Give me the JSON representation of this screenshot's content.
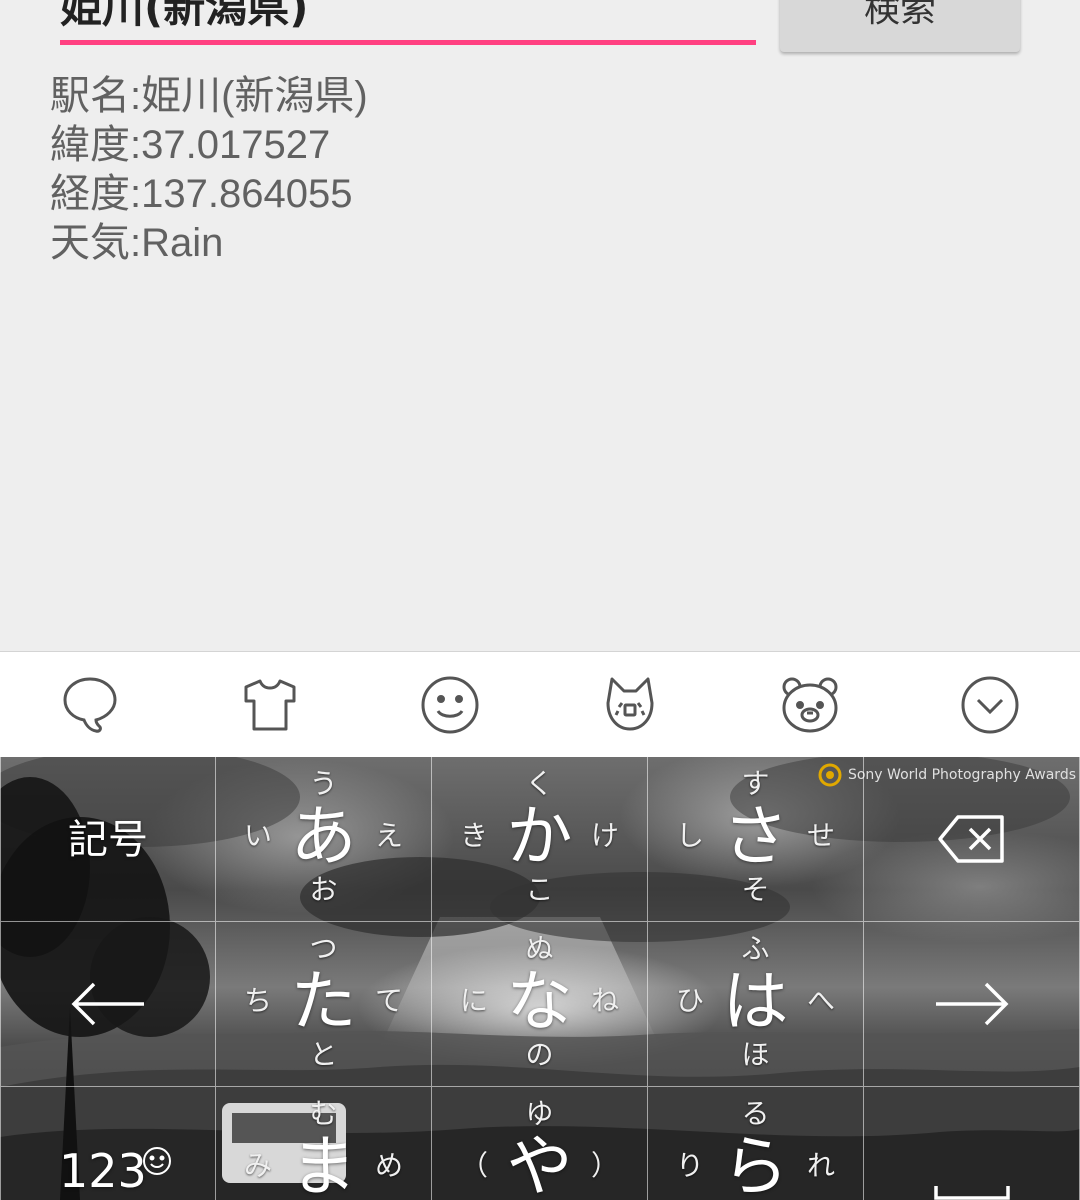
{
  "search": {
    "input_value": "姫川(新潟県)",
    "button_label": "検索"
  },
  "result": {
    "station": "駅名:姫川(新潟県)",
    "latitude": "緯度:37.017527",
    "longitude": "経度:137.864055",
    "weather": "天気:Rain"
  },
  "colors": {
    "accent": "#ff4081",
    "background": "#eeeeee"
  },
  "keyboard": {
    "toolbar_icons": [
      "speech-bubble-icon",
      "tshirt-icon",
      "smiley-icon",
      "cat-face-icon",
      "bear-face-icon",
      "chevron-down-icon"
    ],
    "watermark": "Sony World Photography Awards",
    "keys": {
      "kigo": "記号",
      "a": {
        "main": "あ",
        "top": "う",
        "left": "い",
        "right": "え",
        "bottom": "お"
      },
      "ka": {
        "main": "か",
        "top": "く",
        "left": "き",
        "right": "け",
        "bottom": "こ"
      },
      "sa": {
        "main": "さ",
        "top": "す",
        "left": "し",
        "right": "せ",
        "bottom": "そ"
      },
      "ta": {
        "main": "た",
        "top": "つ",
        "left": "ち",
        "right": "て",
        "bottom": "と"
      },
      "na": {
        "main": "な",
        "top": "ぬ",
        "left": "に",
        "right": "ね",
        "bottom": "の"
      },
      "ha": {
        "main": "は",
        "top": "ふ",
        "left": "ひ",
        "right": "へ",
        "bottom": "ほ"
      },
      "num": "123",
      "ma": {
        "main": "ま",
        "top": "む",
        "left": "み",
        "right": "め"
      },
      "ya": {
        "main": "や",
        "top": "ゆ",
        "left": "（",
        "right": "）"
      },
      "ra": {
        "main": "ら",
        "top": "る",
        "left": "り",
        "right": "れ"
      }
    }
  }
}
